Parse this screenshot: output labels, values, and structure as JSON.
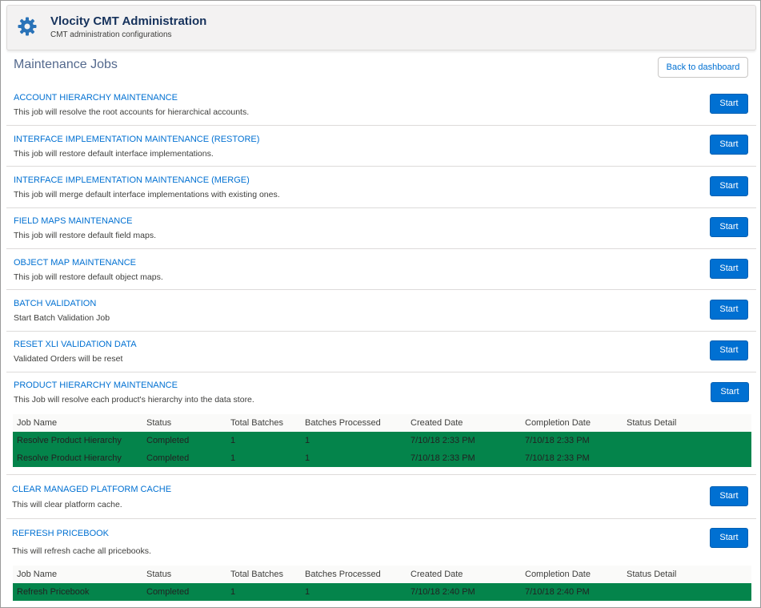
{
  "header": {
    "title": "Vlocity CMT Administration",
    "subtitle": "CMT administration configurations",
    "icon": "gear-icon"
  },
  "page": {
    "title": "Maintenance Jobs",
    "back_label": "Back to dashboard"
  },
  "start_label": "Start",
  "jobs": [
    {
      "title": "ACCOUNT HIERARCHY MAINTENANCE",
      "description": "This job will resolve the root accounts for hierarchical accounts."
    },
    {
      "title": "INTERFACE IMPLEMENTATION MAINTENANCE (RESTORE)",
      "description": "This job will restore default interface implementations."
    },
    {
      "title": "INTERFACE IMPLEMENTATION MAINTENANCE (MERGE)",
      "description": "This job will merge default interface implementations with existing ones."
    },
    {
      "title": "FIELD MAPS MAINTENANCE",
      "description": "This job will restore default field maps."
    },
    {
      "title": "OBJECT MAP MAINTENANCE",
      "description": "This job will restore default object maps."
    },
    {
      "title": "BATCH VALIDATION",
      "description": "Start Batch Validation Job"
    },
    {
      "title": "RESET XLI VALIDATION DATA",
      "description": "Validated Orders will be reset"
    },
    {
      "title": "PRODUCT HIERARCHY MAINTENANCE",
      "description": "This Job will resolve each product's hierarchy into the data store."
    },
    {
      "title": "CLEAR MANAGED PLATFORM CACHE",
      "description": "This will clear platform cache."
    },
    {
      "title": "REFRESH PRICEBOOK",
      "description": "This will refresh cache all pricebooks."
    }
  ],
  "results_columns": [
    "Job Name",
    "Status",
    "Total Batches",
    "Batches Processed",
    "Created Date",
    "Completion Date",
    "Status Detail"
  ],
  "product_hierarchy_results": [
    [
      "Resolve Product Hierarchy",
      "Completed",
      "1",
      "1",
      "7/10/18 2:33 PM",
      "7/10/18 2:33 PM",
      ""
    ],
    [
      "Resolve Product Hierarchy",
      "Completed",
      "1",
      "1",
      "7/10/18 2:33 PM",
      "7/10/18 2:33 PM",
      ""
    ]
  ],
  "pricebook_results": [
    [
      "Refresh Pricebook",
      "Completed",
      "1",
      "1",
      "7/10/18 2:40 PM",
      "7/10/18 2:40 PM",
      ""
    ]
  ],
  "colors": {
    "brand": "#0070d2",
    "success": "#04844b",
    "header_bg": "#f3f2f2"
  }
}
